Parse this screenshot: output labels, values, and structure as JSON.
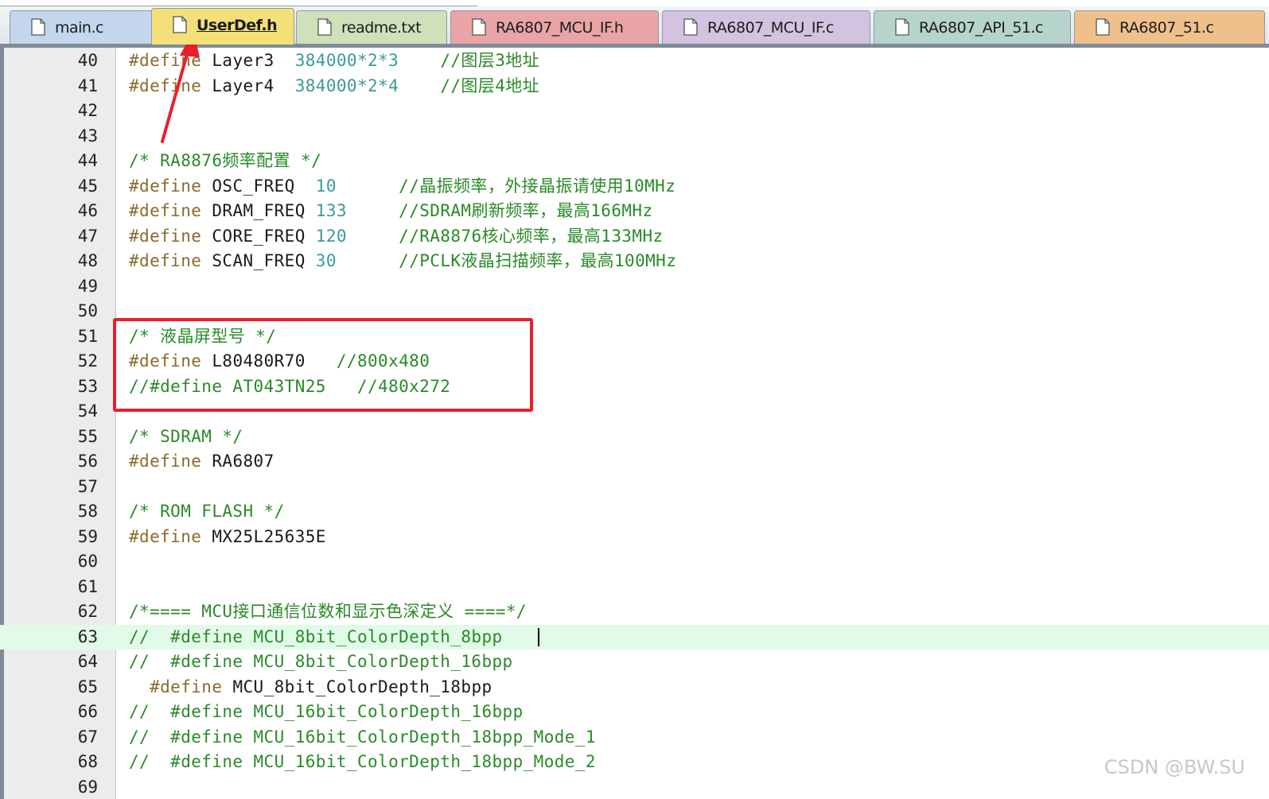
{
  "tabs": [
    {
      "label": "main.c",
      "color": "#c4d6ee",
      "active": false
    },
    {
      "label": "UserDef.h",
      "color": "#f3e078",
      "active": true
    },
    {
      "label": "readme.txt",
      "color": "#cfe0bb",
      "active": false
    },
    {
      "label": "RA6807_MCU_IF.h",
      "color": "#e9a4a6",
      "active": false
    },
    {
      "label": "RA6807_MCU_IF.c",
      "color": "#d2c3e0",
      "active": false
    },
    {
      "label": "RA6807_API_51.c",
      "color": "#b7d4cc",
      "active": false
    },
    {
      "label": "RA6807_51.c",
      "color": "#f0c08c",
      "active": false
    }
  ],
  "editor": {
    "current_line": 63,
    "lines": [
      {
        "n": "40",
        "tokens": [
          {
            "t": "#define",
            "c": "kw"
          },
          {
            "t": " Layer3  ",
            "c": "id"
          },
          {
            "t": "384000*2*3",
            "c": "num"
          },
          {
            "t": "    //图层3地址",
            "c": "cm"
          }
        ]
      },
      {
        "n": "41",
        "tokens": [
          {
            "t": "#define",
            "c": "kw"
          },
          {
            "t": " Layer4  ",
            "c": "id"
          },
          {
            "t": "384000*2*4",
            "c": "num"
          },
          {
            "t": "    //图层4地址",
            "c": "cm"
          }
        ]
      },
      {
        "n": "42",
        "tokens": []
      },
      {
        "n": "43",
        "tokens": []
      },
      {
        "n": "44",
        "tokens": [
          {
            "t": "/* RA8876频率配置 */",
            "c": "cm"
          }
        ]
      },
      {
        "n": "45",
        "tokens": [
          {
            "t": "#define",
            "c": "kw"
          },
          {
            "t": " OSC_FREQ  ",
            "c": "id"
          },
          {
            "t": "10",
            "c": "num"
          },
          {
            "t": "      //晶振频率，外接晶振请使用10MHz",
            "c": "cm"
          }
        ]
      },
      {
        "n": "46",
        "tokens": [
          {
            "t": "#define",
            "c": "kw"
          },
          {
            "t": " DRAM_FREQ ",
            "c": "id"
          },
          {
            "t": "133",
            "c": "num"
          },
          {
            "t": "     //SDRAM刷新频率，最高166MHz",
            "c": "cm"
          }
        ]
      },
      {
        "n": "47",
        "tokens": [
          {
            "t": "#define",
            "c": "kw"
          },
          {
            "t": " CORE_FREQ ",
            "c": "id"
          },
          {
            "t": "120",
            "c": "num"
          },
          {
            "t": "     //RA8876核心频率，最高133MHz",
            "c": "cm"
          }
        ]
      },
      {
        "n": "48",
        "tokens": [
          {
            "t": "#define",
            "c": "kw"
          },
          {
            "t": " SCAN_FREQ ",
            "c": "id"
          },
          {
            "t": "30",
            "c": "num"
          },
          {
            "t": "      //PCLK液晶扫描频率，最高100MHz",
            "c": "cm"
          }
        ]
      },
      {
        "n": "49",
        "tokens": []
      },
      {
        "n": "50",
        "tokens": []
      },
      {
        "n": "51",
        "tokens": [
          {
            "t": "/* 液晶屏型号 */",
            "c": "cm"
          }
        ]
      },
      {
        "n": "52",
        "tokens": [
          {
            "t": "#define",
            "c": "kw"
          },
          {
            "t": " L80480R70   ",
            "c": "id"
          },
          {
            "t": "//800x480",
            "c": "cm"
          }
        ]
      },
      {
        "n": "53",
        "tokens": [
          {
            "t": "//#define AT043TN25   //480x272",
            "c": "cm"
          }
        ]
      },
      {
        "n": "54",
        "tokens": []
      },
      {
        "n": "55",
        "tokens": [
          {
            "t": "/* SDRAM */",
            "c": "cm"
          }
        ]
      },
      {
        "n": "56",
        "tokens": [
          {
            "t": "#define",
            "c": "kw"
          },
          {
            "t": " RA6807",
            "c": "id"
          }
        ]
      },
      {
        "n": "57",
        "tokens": []
      },
      {
        "n": "58",
        "tokens": [
          {
            "t": "/* ROM FLASH */",
            "c": "cm"
          }
        ]
      },
      {
        "n": "59",
        "tokens": [
          {
            "t": "#define",
            "c": "kw"
          },
          {
            "t": " MX25L25635E",
            "c": "id"
          }
        ]
      },
      {
        "n": "60",
        "tokens": []
      },
      {
        "n": "61",
        "tokens": []
      },
      {
        "n": "62",
        "tokens": [
          {
            "t": "/*==== MCU接口通信位数和显示色深定义 ====*/",
            "c": "cm"
          }
        ]
      },
      {
        "n": "63",
        "tokens": [
          {
            "t": "//  #define MCU_8bit_ColorDepth_8bpp",
            "c": "cm"
          }
        ]
      },
      {
        "n": "64",
        "tokens": [
          {
            "t": "//  #define MCU_8bit_ColorDepth_16bpp",
            "c": "cm"
          }
        ]
      },
      {
        "n": "65",
        "tokens": [
          {
            "t": "  ",
            "c": "id"
          },
          {
            "t": "#define",
            "c": "kw"
          },
          {
            "t": " MCU_8bit_ColorDepth_18bpp",
            "c": "id"
          }
        ]
      },
      {
        "n": "66",
        "tokens": [
          {
            "t": "//  #define MCU_16bit_ColorDepth_16bpp",
            "c": "cm"
          }
        ]
      },
      {
        "n": "67",
        "tokens": [
          {
            "t": "//  #define MCU_16bit_ColorDepth_18bpp_Mode_1",
            "c": "cm"
          }
        ]
      },
      {
        "n": "68",
        "tokens": [
          {
            "t": "//  #define MCU_16bit_ColorDepth_18bpp_Mode_2",
            "c": "cm"
          }
        ]
      },
      {
        "n": "69",
        "tokens": []
      }
    ]
  },
  "annotation": {
    "highlighted_lines": [
      "51",
      "52",
      "53"
    ],
    "arrow_target": "UserDef.h",
    "color": "#e8202a"
  },
  "watermark": "CSDN @BW.SU"
}
